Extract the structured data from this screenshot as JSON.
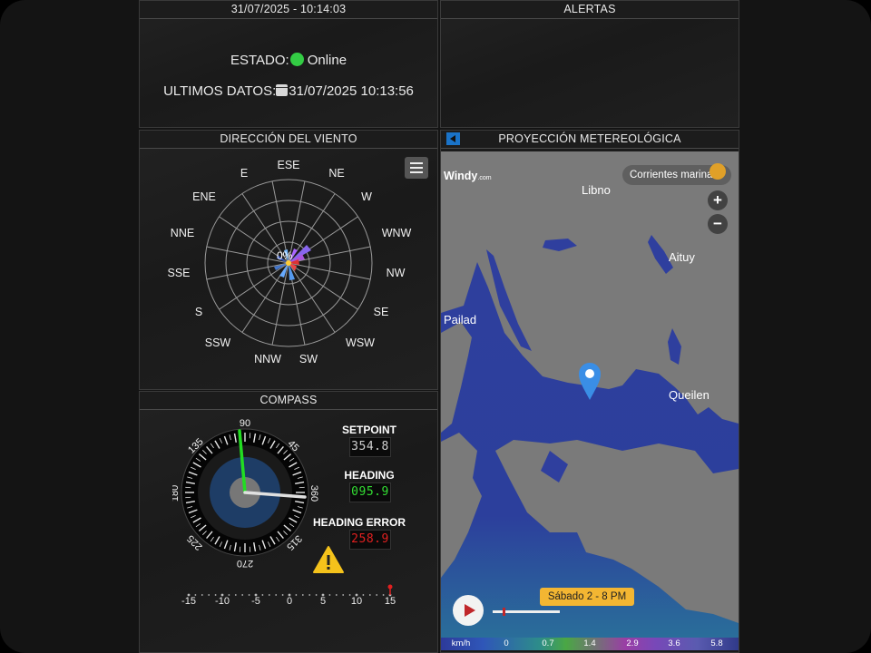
{
  "header": {
    "datetime": "31/07/2025 - 10:14:03"
  },
  "status": {
    "estado_label": "ESTADO:",
    "estado_value": "Online",
    "ultimos_label": "ULTIMOS DATOS:",
    "ultimos_value": "31/07/2025 10:13:56"
  },
  "alertas": {
    "title": "ALERTAS"
  },
  "wind": {
    "title": "DIRECCIÓN DEL VIENTO",
    "center_label": "0%",
    "directions": [
      "ESE",
      "NE",
      "W",
      "WNW",
      "NW",
      "SE",
      "WSW",
      "SW",
      "NNW",
      "SSW",
      "S",
      "SSE",
      "NNE",
      "ENE",
      "E"
    ]
  },
  "map": {
    "title": "PROYECCIÓN METEREOLÓGICA",
    "brand": "Windy",
    "brand_suffix": ".com",
    "layer_button": "Corrientes marinas",
    "zoom_in": "+",
    "zoom_out": "−",
    "places": [
      "Libno",
      "Aituy",
      "Pailad",
      "Queilen"
    ],
    "time_label": "Sábado 2 - 8 PM",
    "legend_unit": "km/h",
    "legend_values": [
      "0",
      "0.7",
      "1.4",
      "2.9",
      "3.6",
      "5.8"
    ]
  },
  "compass": {
    "title": "COMPASS",
    "dial_labels": [
      "90",
      "45",
      "360",
      "315",
      "270",
      "225",
      "180",
      "135"
    ],
    "setpoint_label": "SETPOINT",
    "setpoint_value": "354.8",
    "heading_label": "HEADING",
    "heading_value": "095.9",
    "error_label": "HEADING ERROR",
    "error_value": "258.9",
    "scale_labels": [
      "-15",
      "-10",
      "-5",
      "0",
      "5",
      "10",
      "15"
    ],
    "colors": {
      "setpoint": "#d0d0d0",
      "heading": "#33dd33",
      "error": "#e02020",
      "needle_green": "#22dd22"
    }
  }
}
